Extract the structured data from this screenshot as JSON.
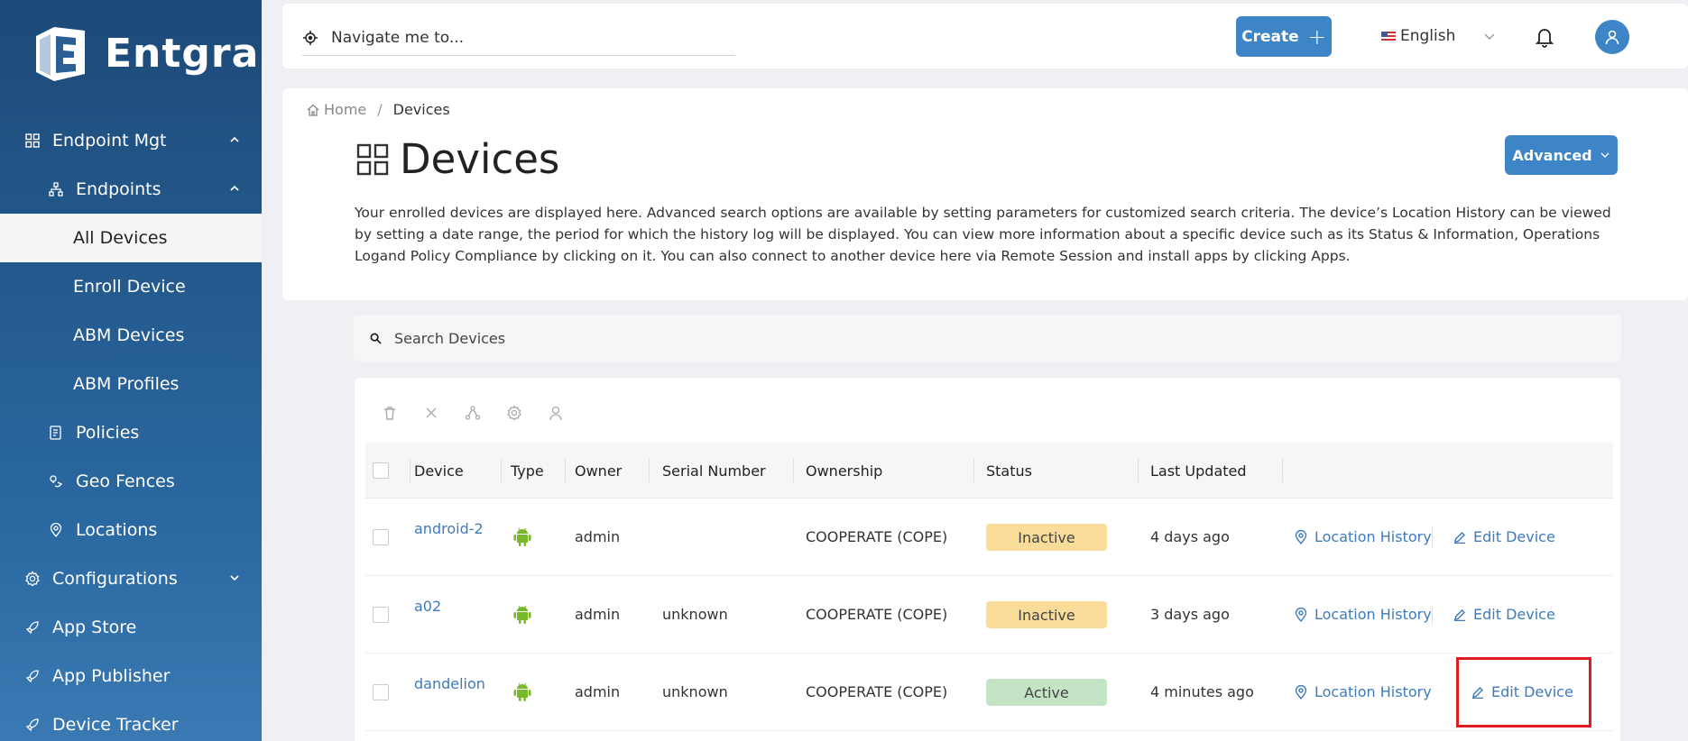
{
  "sidebar": {
    "brand": "Entgra",
    "items": [
      {
        "label": "Endpoint Mgt"
      },
      {
        "label": "Endpoints"
      },
      {
        "label": "All Devices"
      },
      {
        "label": "Enroll Device"
      },
      {
        "label": "ABM Devices"
      },
      {
        "label": "ABM Profiles"
      },
      {
        "label": "Policies"
      },
      {
        "label": "Geo Fences"
      },
      {
        "label": "Locations"
      },
      {
        "label": "Configurations"
      },
      {
        "label": "App Store"
      },
      {
        "label": "App Publisher"
      },
      {
        "label": "Device Tracker"
      }
    ]
  },
  "header": {
    "nav_placeholder": "Navigate me to...",
    "create_label": "Create",
    "language": "English"
  },
  "page": {
    "breadcrumb_home": "Home",
    "breadcrumb_current": "Devices",
    "title": "Devices",
    "advanced_label": "Advanced",
    "description": "Your enrolled devices are displayed here. Advanced search options are available by setting parameters for customized search criteria. The device’s Location History can be viewed by setting a date range, the period for which the history log will be displayed. You can view more information about a specific device such as its Status & Information, Operations Logand Policy Compliance by clicking on it. You can also connect to another device here via Remote Session and install apps by clicking Apps."
  },
  "search": {
    "placeholder": "Search Devices"
  },
  "table": {
    "columns": {
      "device": "Device",
      "type": "Type",
      "owner": "Owner",
      "serial": "Serial Number",
      "ownership": "Ownership",
      "status": "Status",
      "updated": "Last Updated"
    },
    "rows": [
      {
        "device": "android-2",
        "owner": "admin",
        "serial": "",
        "ownership": "COOPERATE (COPE)",
        "status": "Inactive",
        "updated": "4 days ago",
        "loc": "Location History",
        "edit": "Edit Device"
      },
      {
        "device": "a02",
        "owner": "admin",
        "serial": "unknown",
        "ownership": "COOPERATE (COPE)",
        "status": "Inactive",
        "updated": "3 days ago",
        "loc": "Location History",
        "edit": "Edit Device"
      },
      {
        "device": "dandelion",
        "owner": "admin",
        "serial": "unknown",
        "ownership": "COOPERATE (COPE)",
        "status": "Active",
        "updated": "4 minutes ago",
        "loc": "Location History",
        "edit": "Edit Device"
      }
    ]
  },
  "colors": {
    "sidebar_top": "#1d4a78",
    "accent": "#3d85c6",
    "inactive_badge": "#f9dc99",
    "active_badge": "#c3e4c5",
    "highlight": "#e01b22",
    "android": "#78b82a"
  }
}
